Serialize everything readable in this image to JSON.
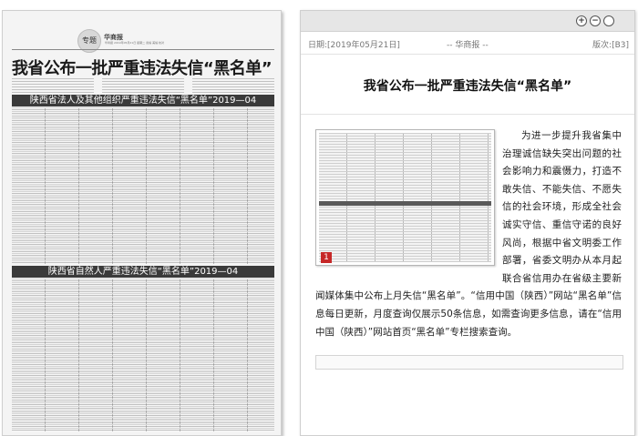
{
  "newspaper": {
    "badge": "专题",
    "masthead": "华商报",
    "dateline": "华商报 2019年05月21日 星期二 责编 美编 校对",
    "headline": "我省公布一批严重违法失信“黑名单”",
    "section1_title": "陕西省法人及其他组织严重违法失信“黑名单”2019—04",
    "section2_title": "陕西省自然人严重违法失信“黑名单”2019—04"
  },
  "reader": {
    "toolbar": {
      "zoom_in": "+",
      "zoom_out": "−",
      "reset": ""
    },
    "meta": {
      "date": "日期:[2019年05月21日]",
      "source": "-- 华商报 --",
      "page": "版次:[B3]"
    },
    "title": "我省公布一批严重违法失信“黑名单”",
    "thumbnail_number": "1",
    "body": "为进一步提升我省集中治理诚信缺失突出问题的社会影响力和震慑力，打造不敢失信、不能失信、不愿失信的社会环境，形成全社会诚实守信、重信守诺的良好风尚，根据中省文明委工作部署，省委文明办从本月起联合省信用办在省级主要新闻媒体集中公布上月失信“黑名单”。“信用中国（陕西）”网站“黑名单”信息每日更新，月度查询仅展示50条信息，如需查询更多信息，请在“信用中国（陕西）”网站首页“黑名单”专栏搜索查询。"
  },
  "colors": {
    "section_header_bg": "#3a3a3a",
    "thumb_number_bg": "#c62828"
  }
}
